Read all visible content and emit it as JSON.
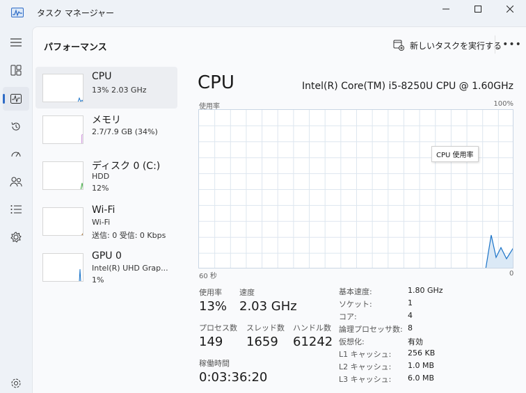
{
  "window": {
    "title": "タスク マネージャー",
    "controls": {
      "minimize": "minimize-icon",
      "maximize": "maximize-icon",
      "close": "close-icon"
    }
  },
  "nav": {
    "items": [
      {
        "name": "hamburger-menu-icon"
      },
      {
        "name": "processes-icon"
      },
      {
        "name": "performance-icon",
        "active": true
      },
      {
        "name": "app-history-icon"
      },
      {
        "name": "startup-apps-icon"
      },
      {
        "name": "users-icon"
      },
      {
        "name": "details-icon"
      },
      {
        "name": "services-icon"
      },
      {
        "name": "settings-icon"
      }
    ]
  },
  "header": {
    "title": "パフォーマンス",
    "run_task_label": "新しいタスクを実行する",
    "more_label": "•••"
  },
  "devices": [
    {
      "name": "CPU",
      "sub1": "13%  2.03 GHz",
      "sub2": "",
      "selected": true,
      "color": "#1a73c8"
    },
    {
      "name": "メモリ",
      "sub1": "2.7/7.9 GB (34%)",
      "sub2": "",
      "color": "#a33bbd"
    },
    {
      "name": "ディスク 0 (C:)",
      "sub1": "HDD",
      "sub2": "12%",
      "color": "#4caf50"
    },
    {
      "name": "Wi-Fi",
      "sub1": "Wi-Fi",
      "sub2": "送信: 0 受信: 0 Kbps",
      "color": "#a06a2a"
    },
    {
      "name": "GPU 0",
      "sub1": "Intel(R) UHD Grap...",
      "sub2": "1%",
      "color": "#1a73c8"
    }
  ],
  "detail": {
    "title": "CPU",
    "model": "Intel(R) Core(TM) i5-8250U CPU @ 1.60GHz",
    "graph_top_label": "使用率",
    "graph_max_label": "100%",
    "graph_time_label": "60 秒",
    "graph_min_label": "0",
    "tooltip": "CPU 使用率",
    "stats": {
      "usage_label": "使用率",
      "usage_value": "13%",
      "speed_label": "速度",
      "speed_value": "2.03 GHz",
      "process_label": "プロセス数",
      "process_value": "149",
      "thread_label": "スレッド数",
      "thread_value": "1659",
      "handle_label": "ハンドル数",
      "handle_value": "61242",
      "uptime_label": "稼働時間",
      "uptime_value": "0:03:36:20"
    },
    "specs": [
      {
        "label": "基本速度:",
        "value": "1.80 GHz"
      },
      {
        "label": "ソケット:",
        "value": "1"
      },
      {
        "label": "コア:",
        "value": "4"
      },
      {
        "label": "論理プロセッサ数:",
        "value": "8"
      },
      {
        "label": "仮想化:",
        "value": "有効"
      },
      {
        "label": "L1 キャッシュ:",
        "value": "256 KB"
      },
      {
        "label": "L2 キャッシュ:",
        "value": "1.0 MB"
      },
      {
        "label": "L3 キャッシュ:",
        "value": "6.0 MB"
      }
    ]
  },
  "colors": {
    "accent": "#2e6bc6",
    "cpu_line": "#1a73c8",
    "graph_grid": "#dde6ef"
  }
}
